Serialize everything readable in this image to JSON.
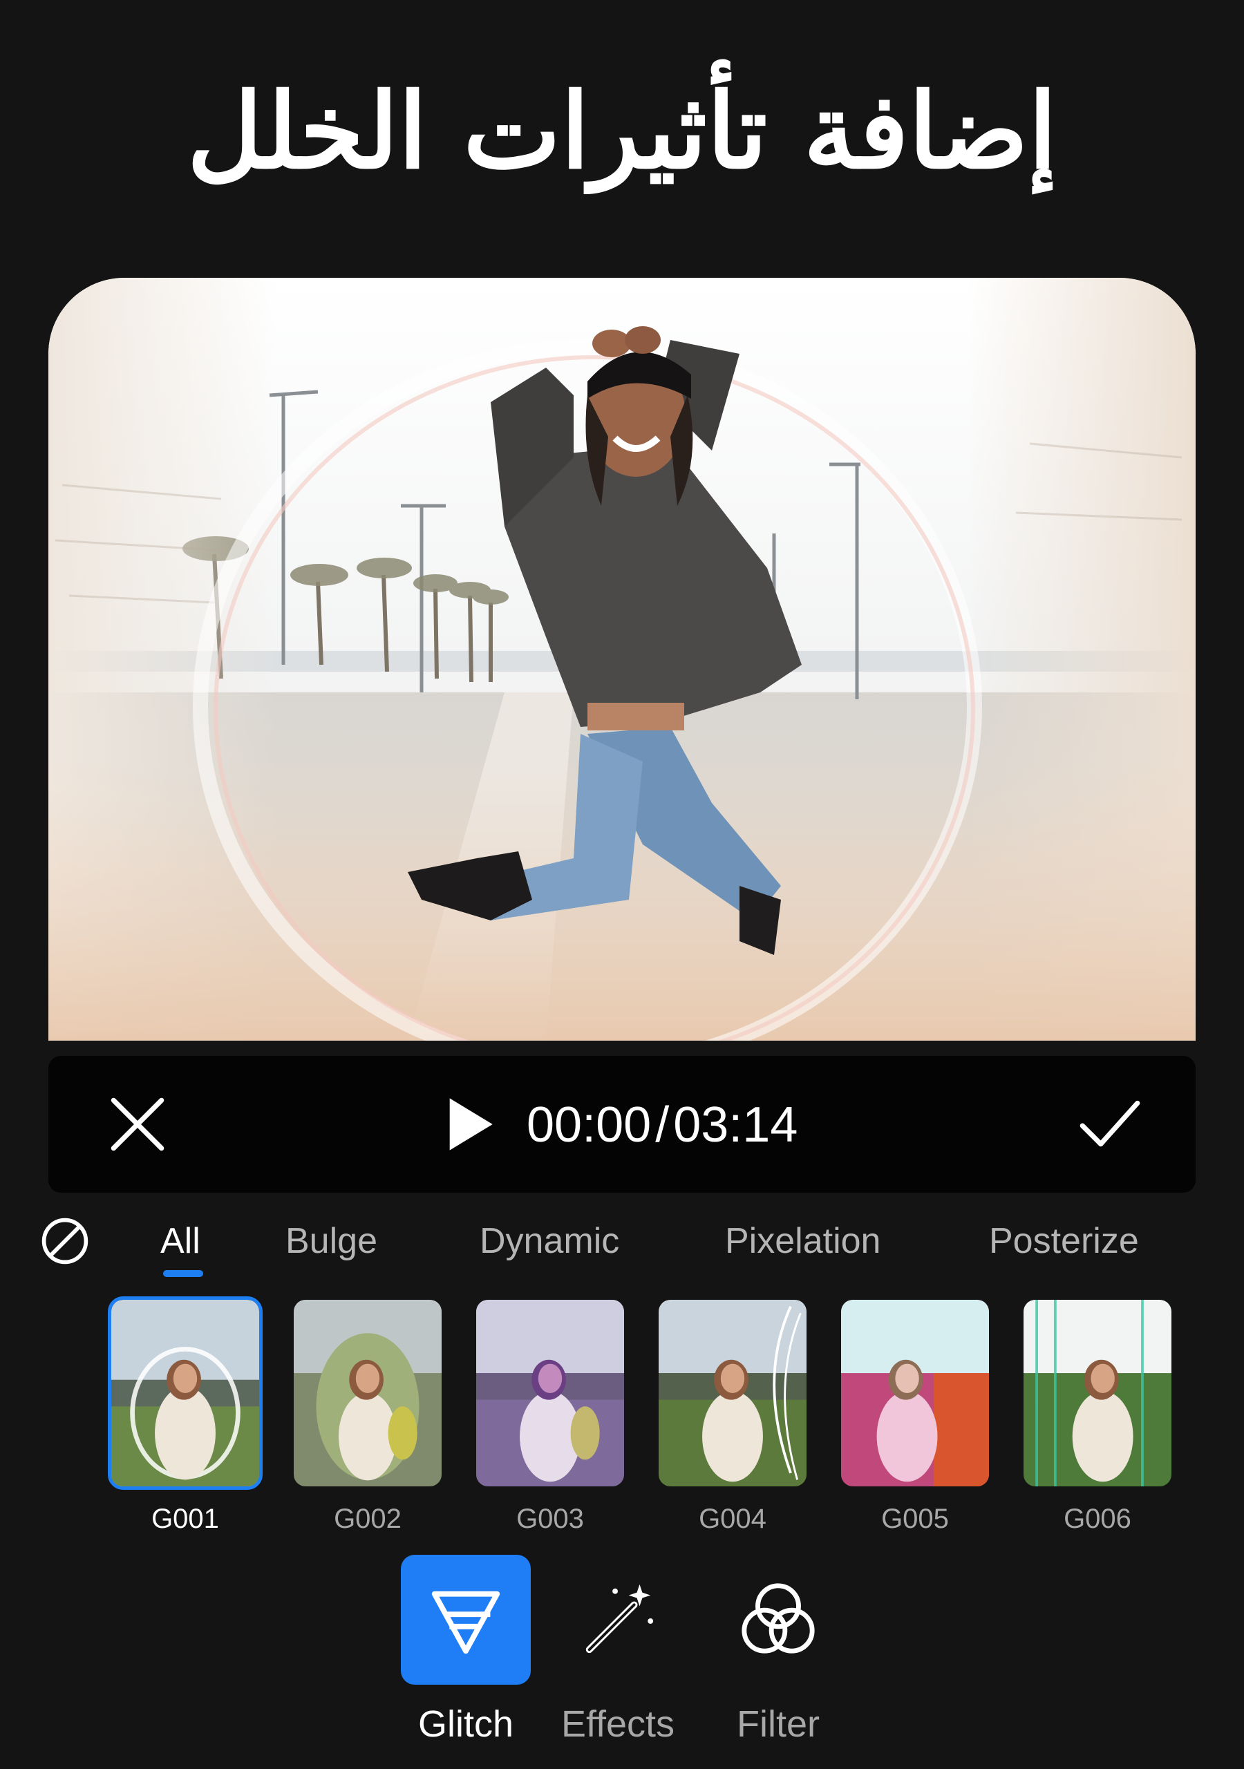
{
  "headline": "إضافة تأثيرات الخلل",
  "player": {
    "current_time": "00:00",
    "separator": "/",
    "total_time": "03:14"
  },
  "categories": [
    "All",
    "Bulge",
    "Dynamic",
    "Pixelation",
    "Posterize"
  ],
  "selected_category": "All",
  "thumbnails": [
    {
      "label": "G001",
      "selected": true
    },
    {
      "label": "G002",
      "selected": false
    },
    {
      "label": "G003",
      "selected": false
    },
    {
      "label": "G004",
      "selected": false
    },
    {
      "label": "G005",
      "selected": false
    },
    {
      "label": "G006",
      "selected": false
    }
  ],
  "tools": [
    {
      "label": "Glitch",
      "icon": "glitch-icon",
      "active": true
    },
    {
      "label": "Effects",
      "icon": "magic-wand-icon",
      "active": false
    },
    {
      "label": "Filter",
      "icon": "filter-circles-icon",
      "active": false
    }
  ],
  "colors": {
    "background": "#141414",
    "accent": "#1d7ff2",
    "playbar": "#040404",
    "inactive_text": "#b5b5b5"
  }
}
